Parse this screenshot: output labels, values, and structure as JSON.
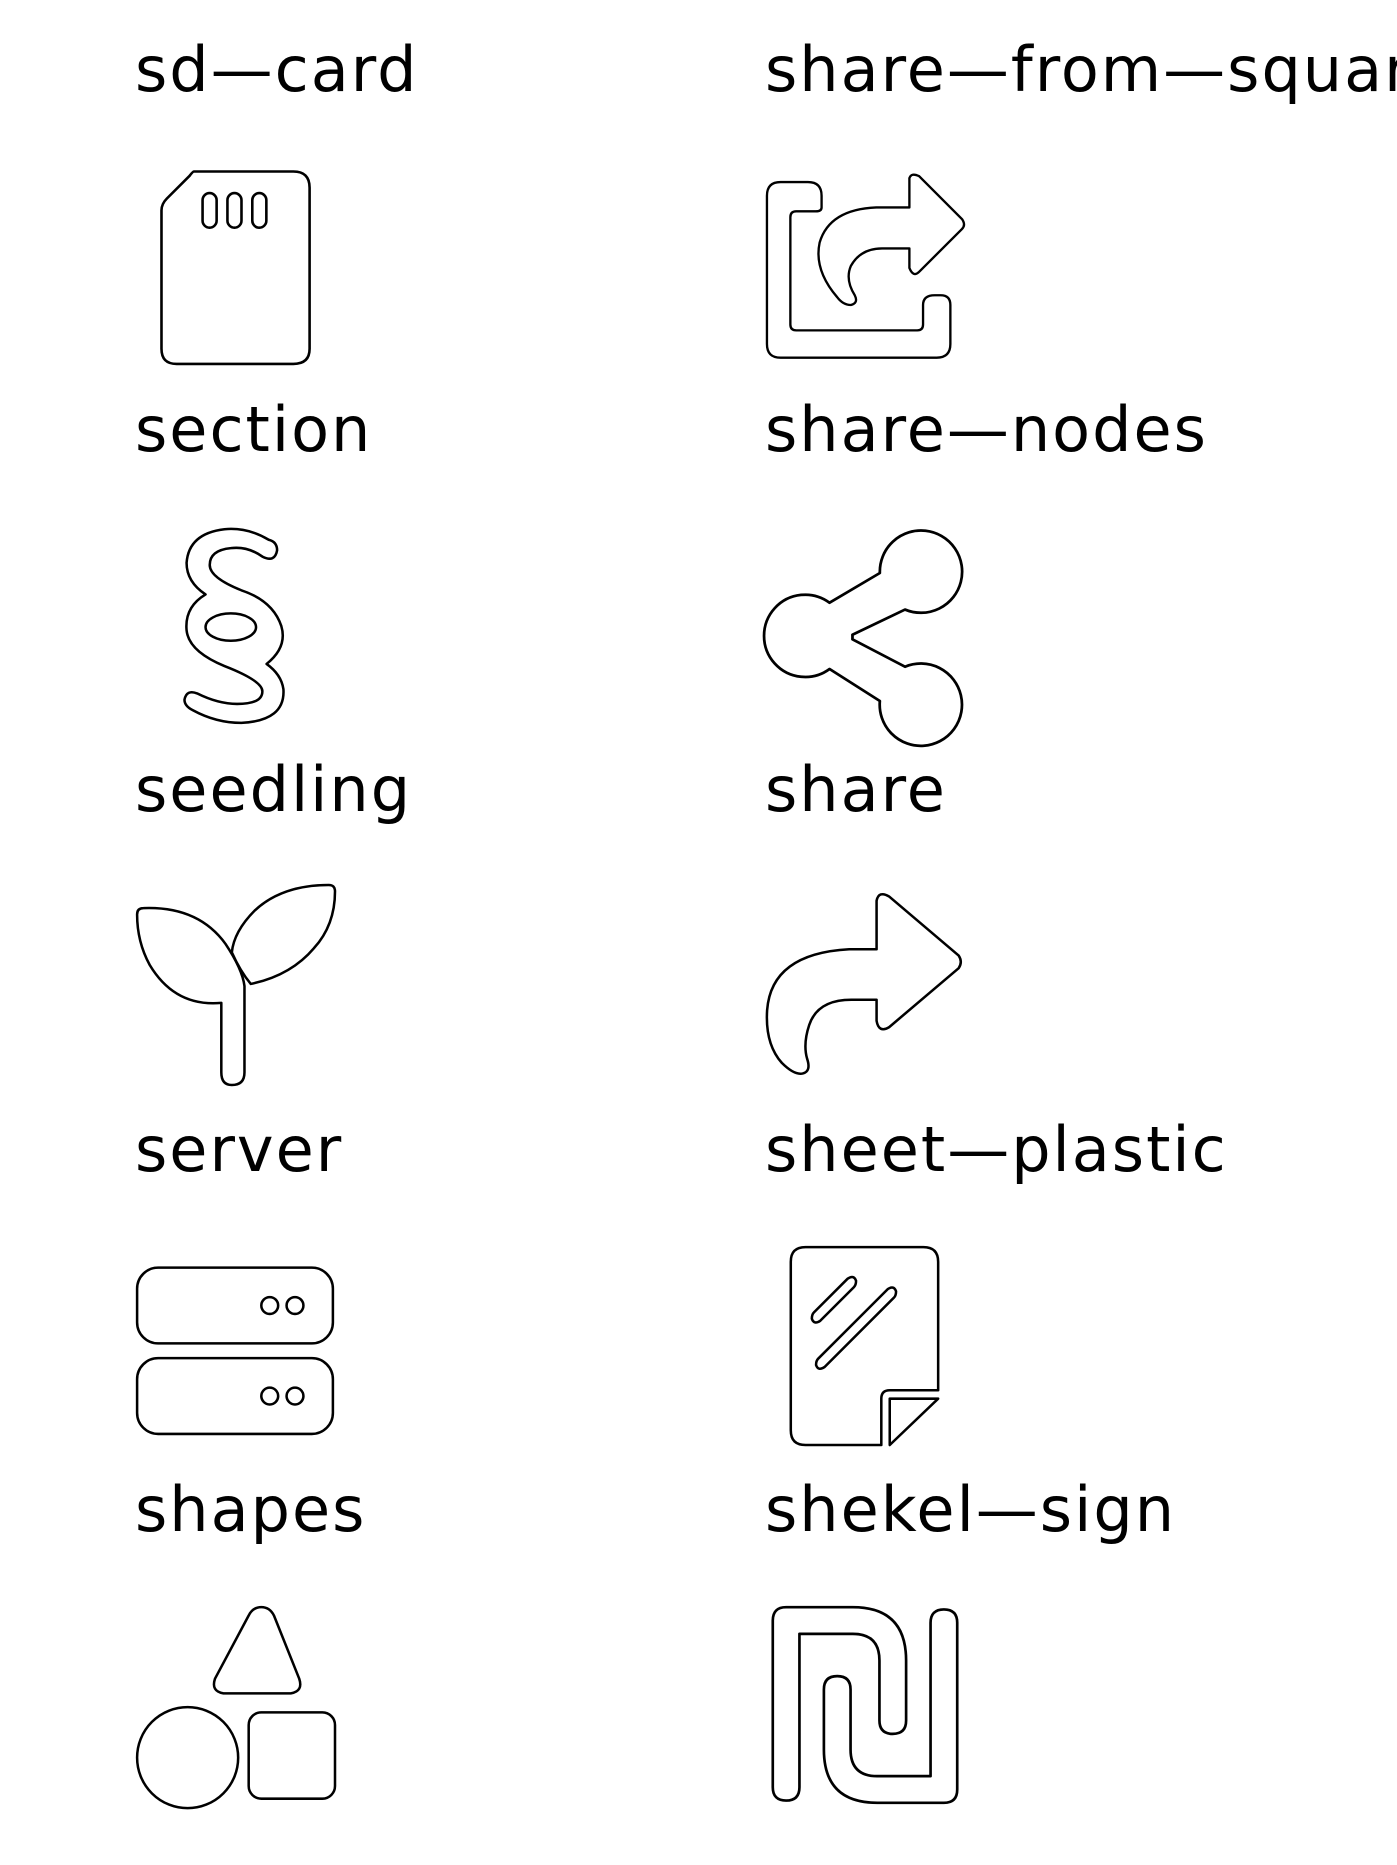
{
  "icons": [
    {
      "label": "sd—card",
      "icon": "sd-card-icon"
    },
    {
      "label": "share—from—square",
      "icon": "share-from-square-icon"
    },
    {
      "label": "section",
      "icon": "section-icon"
    },
    {
      "label": "share—nodes",
      "icon": "share-nodes-icon"
    },
    {
      "label": "seedling",
      "icon": "seedling-icon"
    },
    {
      "label": "share",
      "icon": "share-icon"
    },
    {
      "label": "server",
      "icon": "server-icon"
    },
    {
      "label": "sheet—plastic",
      "icon": "sheet-plastic-icon"
    },
    {
      "label": "shapes",
      "icon": "shapes-icon"
    },
    {
      "label": "shekel—sign",
      "icon": "shekel-sign-icon"
    }
  ],
  "colors": {
    "background": "#ffffff",
    "stroke": "#000000"
  }
}
